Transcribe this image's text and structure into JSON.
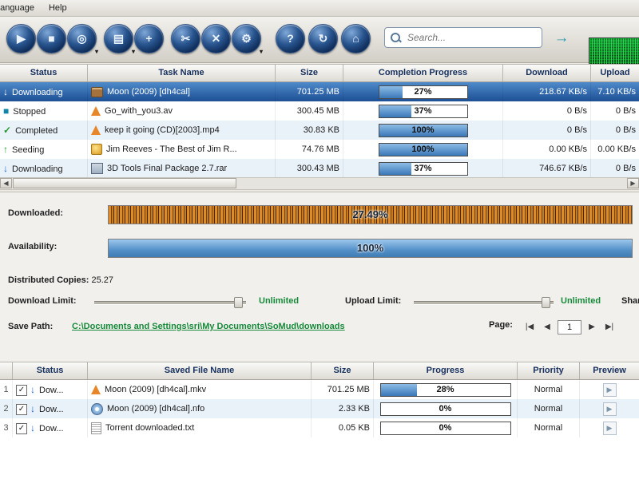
{
  "colors": {
    "selected_row": "#2f66ad",
    "progress_fill": "#4a86c2",
    "link_green": "#178a3a",
    "status_blue": "#1a66c2",
    "status_teal": "#0e86a8",
    "status_green": "#1f9a2e"
  },
  "menu": {
    "items": [
      "Language",
      "Help"
    ]
  },
  "toolbar": {
    "buttons": [
      {
        "name": "start-button",
        "glyph": "▶"
      },
      {
        "name": "stop-button",
        "glyph": "■"
      },
      {
        "name": "network-button",
        "glyph": "◎"
      },
      {
        "name": "open-file-button",
        "glyph": "▤"
      },
      {
        "name": "add-task-button",
        "glyph": "+"
      },
      {
        "name": "tools-button",
        "glyph": "✂"
      },
      {
        "name": "delete-button",
        "glyph": "✕"
      },
      {
        "name": "settings-button",
        "glyph": "⚙"
      },
      {
        "name": "help-button",
        "glyph": "?"
      },
      {
        "name": "refresh-button",
        "glyph": "↻"
      },
      {
        "name": "home-button",
        "glyph": "⌂"
      }
    ],
    "search_placeholder": "Search...",
    "go_glyph": "→"
  },
  "scrollbar": {
    "left": "◀",
    "right": "▶"
  },
  "tasks_table": {
    "columns": [
      "Status",
      "Task Name",
      "Size",
      "Completion Progress",
      "Download",
      "Upload"
    ],
    "rows": [
      {
        "status": "Downloading",
        "icon": "↓",
        "icon_color": "#1a66c2",
        "file_icon": "film",
        "name": "Moon (2009) [dh4cal]",
        "size": "701.25 MB",
        "progress_label": "27%",
        "progress_pct": 27,
        "download": "218.67 KB/s",
        "upload": "7.10 KB/s"
      },
      {
        "status": "Stopped",
        "icon": "■",
        "icon_color": "#0e86a8",
        "file_icon": "cone",
        "name": "Go_with_you3.av",
        "size": "300.45 MB",
        "progress_label": "37%",
        "progress_pct": 37,
        "download": "0 B/s",
        "upload": "0 B/s"
      },
      {
        "status": "Completed",
        "icon": "✓",
        "icon_color": "#1f9a2e",
        "file_icon": "cone",
        "name": "keep it going (CD)[2003].mp4",
        "size": "30.83 KB",
        "progress_label": "100%",
        "progress_pct": 100,
        "download": "0 B/s",
        "upload": "0 B/s"
      },
      {
        "status": "Seeding",
        "icon": "↑",
        "icon_color": "#1f9a2e",
        "file_icon": "music",
        "name": "Jim Reeves - The Best of Jim R...",
        "size": "74.76 MB",
        "progress_label": "100%",
        "progress_pct": 100,
        "download": "0.00 KB/s",
        "upload": "0.00 KB/s"
      },
      {
        "status": "Downloading",
        "icon": "↓",
        "icon_color": "#1a66c2",
        "file_icon": "pkg",
        "name": "3D Tools Final Package 2.7.rar",
        "size": "300.43 MB",
        "progress_label": "37%",
        "progress_pct": 37,
        "download": "746.67 KB/s",
        "upload": "0 B/s"
      }
    ]
  },
  "details": {
    "downloaded_label": "Downloaded:",
    "downloaded_value": "27.49%",
    "downloaded_pct": 27.49,
    "availability_label": "Availability:",
    "availability_value": "100%",
    "availability_pct": 100,
    "distributed_label": "Distributed Copies:",
    "distributed_value": "25.27",
    "download_limit_label": "Download Limit:",
    "download_limit_value": "Unlimited",
    "upload_limit_label": "Upload Limit:",
    "upload_limit_value": "Unlimited",
    "share_label": "Share",
    "save_path_label": "Save Path:",
    "save_path": "C:\\Documents and Settings\\sri\\My Documents\\SoMud\\downloads",
    "pager": {
      "label": "Page:",
      "value": "1",
      "first": "|◀",
      "prev": "◀",
      "next": "▶",
      "last": "▶|"
    }
  },
  "files_table": {
    "columns": [
      "",
      "Status",
      "Saved File Name",
      "Size",
      "Progress",
      "Priority",
      "Preview"
    ],
    "rows": [
      {
        "num": "1",
        "checked": "✓",
        "status": "Dow...",
        "icon": "↓",
        "icon_color": "#1a66c2",
        "file_icon": "cone",
        "name": "Moon (2009) [dh4cal].mkv",
        "size": "701.25 MB",
        "progress_label": "28%",
        "progress_pct": 28,
        "priority": "Normal",
        "preview_glyph": "▶"
      },
      {
        "num": "2",
        "checked": "✓",
        "status": "Dow...",
        "icon": "↓",
        "icon_color": "#1a66c2",
        "file_icon": "disc",
        "name": "Moon (2009) [dh4cal].nfo",
        "size": "2.33 KB",
        "progress_label": "0%",
        "progress_pct": 0,
        "priority": "Normal",
        "preview_glyph": "▶"
      },
      {
        "num": "3",
        "checked": "✓",
        "status": "Dow...",
        "icon": "↓",
        "icon_color": "#1a66c2",
        "file_icon": "txt",
        "name": "Torrent downloaded.txt",
        "size": "0.05 KB",
        "progress_label": "0%",
        "progress_pct": 0,
        "priority": "Normal",
        "preview_glyph": "▶"
      }
    ]
  }
}
